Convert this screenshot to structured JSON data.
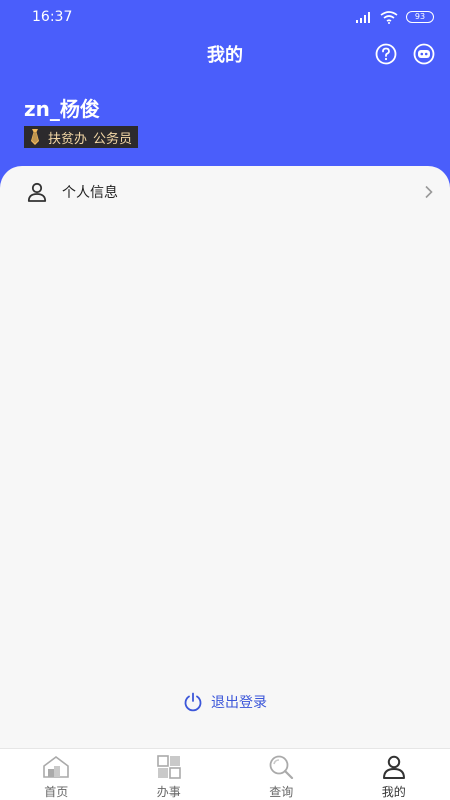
{
  "status_bar": {
    "time": "16:37",
    "battery": "93"
  },
  "header": {
    "title": "我的"
  },
  "user": {
    "name": "zn_杨俊",
    "org": "扶贫办",
    "role": "公务员"
  },
  "menu": [
    {
      "label": "个人信息",
      "icon": "person-icon"
    }
  ],
  "logout_label": "退出登录",
  "tabs": [
    {
      "label": "首页",
      "icon": "home-icon"
    },
    {
      "label": "办事",
      "icon": "grid-icon"
    },
    {
      "label": "查询",
      "icon": "search-icon"
    },
    {
      "label": "我的",
      "icon": "profile-icon",
      "active": true
    }
  ],
  "colors": {
    "brand": "#4a5efb",
    "accent": "#3b56d9",
    "badge_bg": "#2c2a2d",
    "badge_text": "#f2d7a6"
  }
}
